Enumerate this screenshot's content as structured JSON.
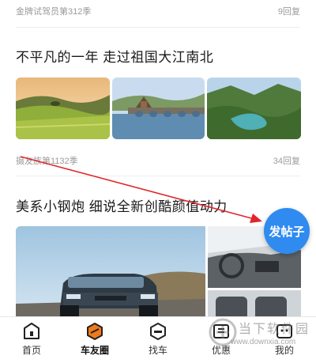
{
  "post1": {
    "author": "金牌试驾员第312季",
    "replies": "9回复"
  },
  "post2": {
    "title": "不平凡的一年 走过祖国大江南北",
    "author": "摄友族第1132季",
    "replies": "34回复"
  },
  "post3": {
    "title": "美系小钢炮 细说全新创酷颜值动力"
  },
  "fab": {
    "label": "发帖子",
    "color": "#2f8bf0"
  },
  "annotation": {
    "color": "#e0262b"
  },
  "tabbar": {
    "items": [
      {
        "label": "首页",
        "icon": "home-icon"
      },
      {
        "label": "车友圈",
        "icon": "car-club-icon",
        "active": true,
        "color": "#f07a1a"
      },
      {
        "label": "找车",
        "icon": "find-car-icon"
      },
      {
        "label": "优惠",
        "icon": "discount-icon"
      },
      {
        "label": "我的",
        "icon": "profile-icon"
      }
    ]
  },
  "watermark": {
    "title": "当下软件园",
    "url": "www.downxia.com"
  }
}
